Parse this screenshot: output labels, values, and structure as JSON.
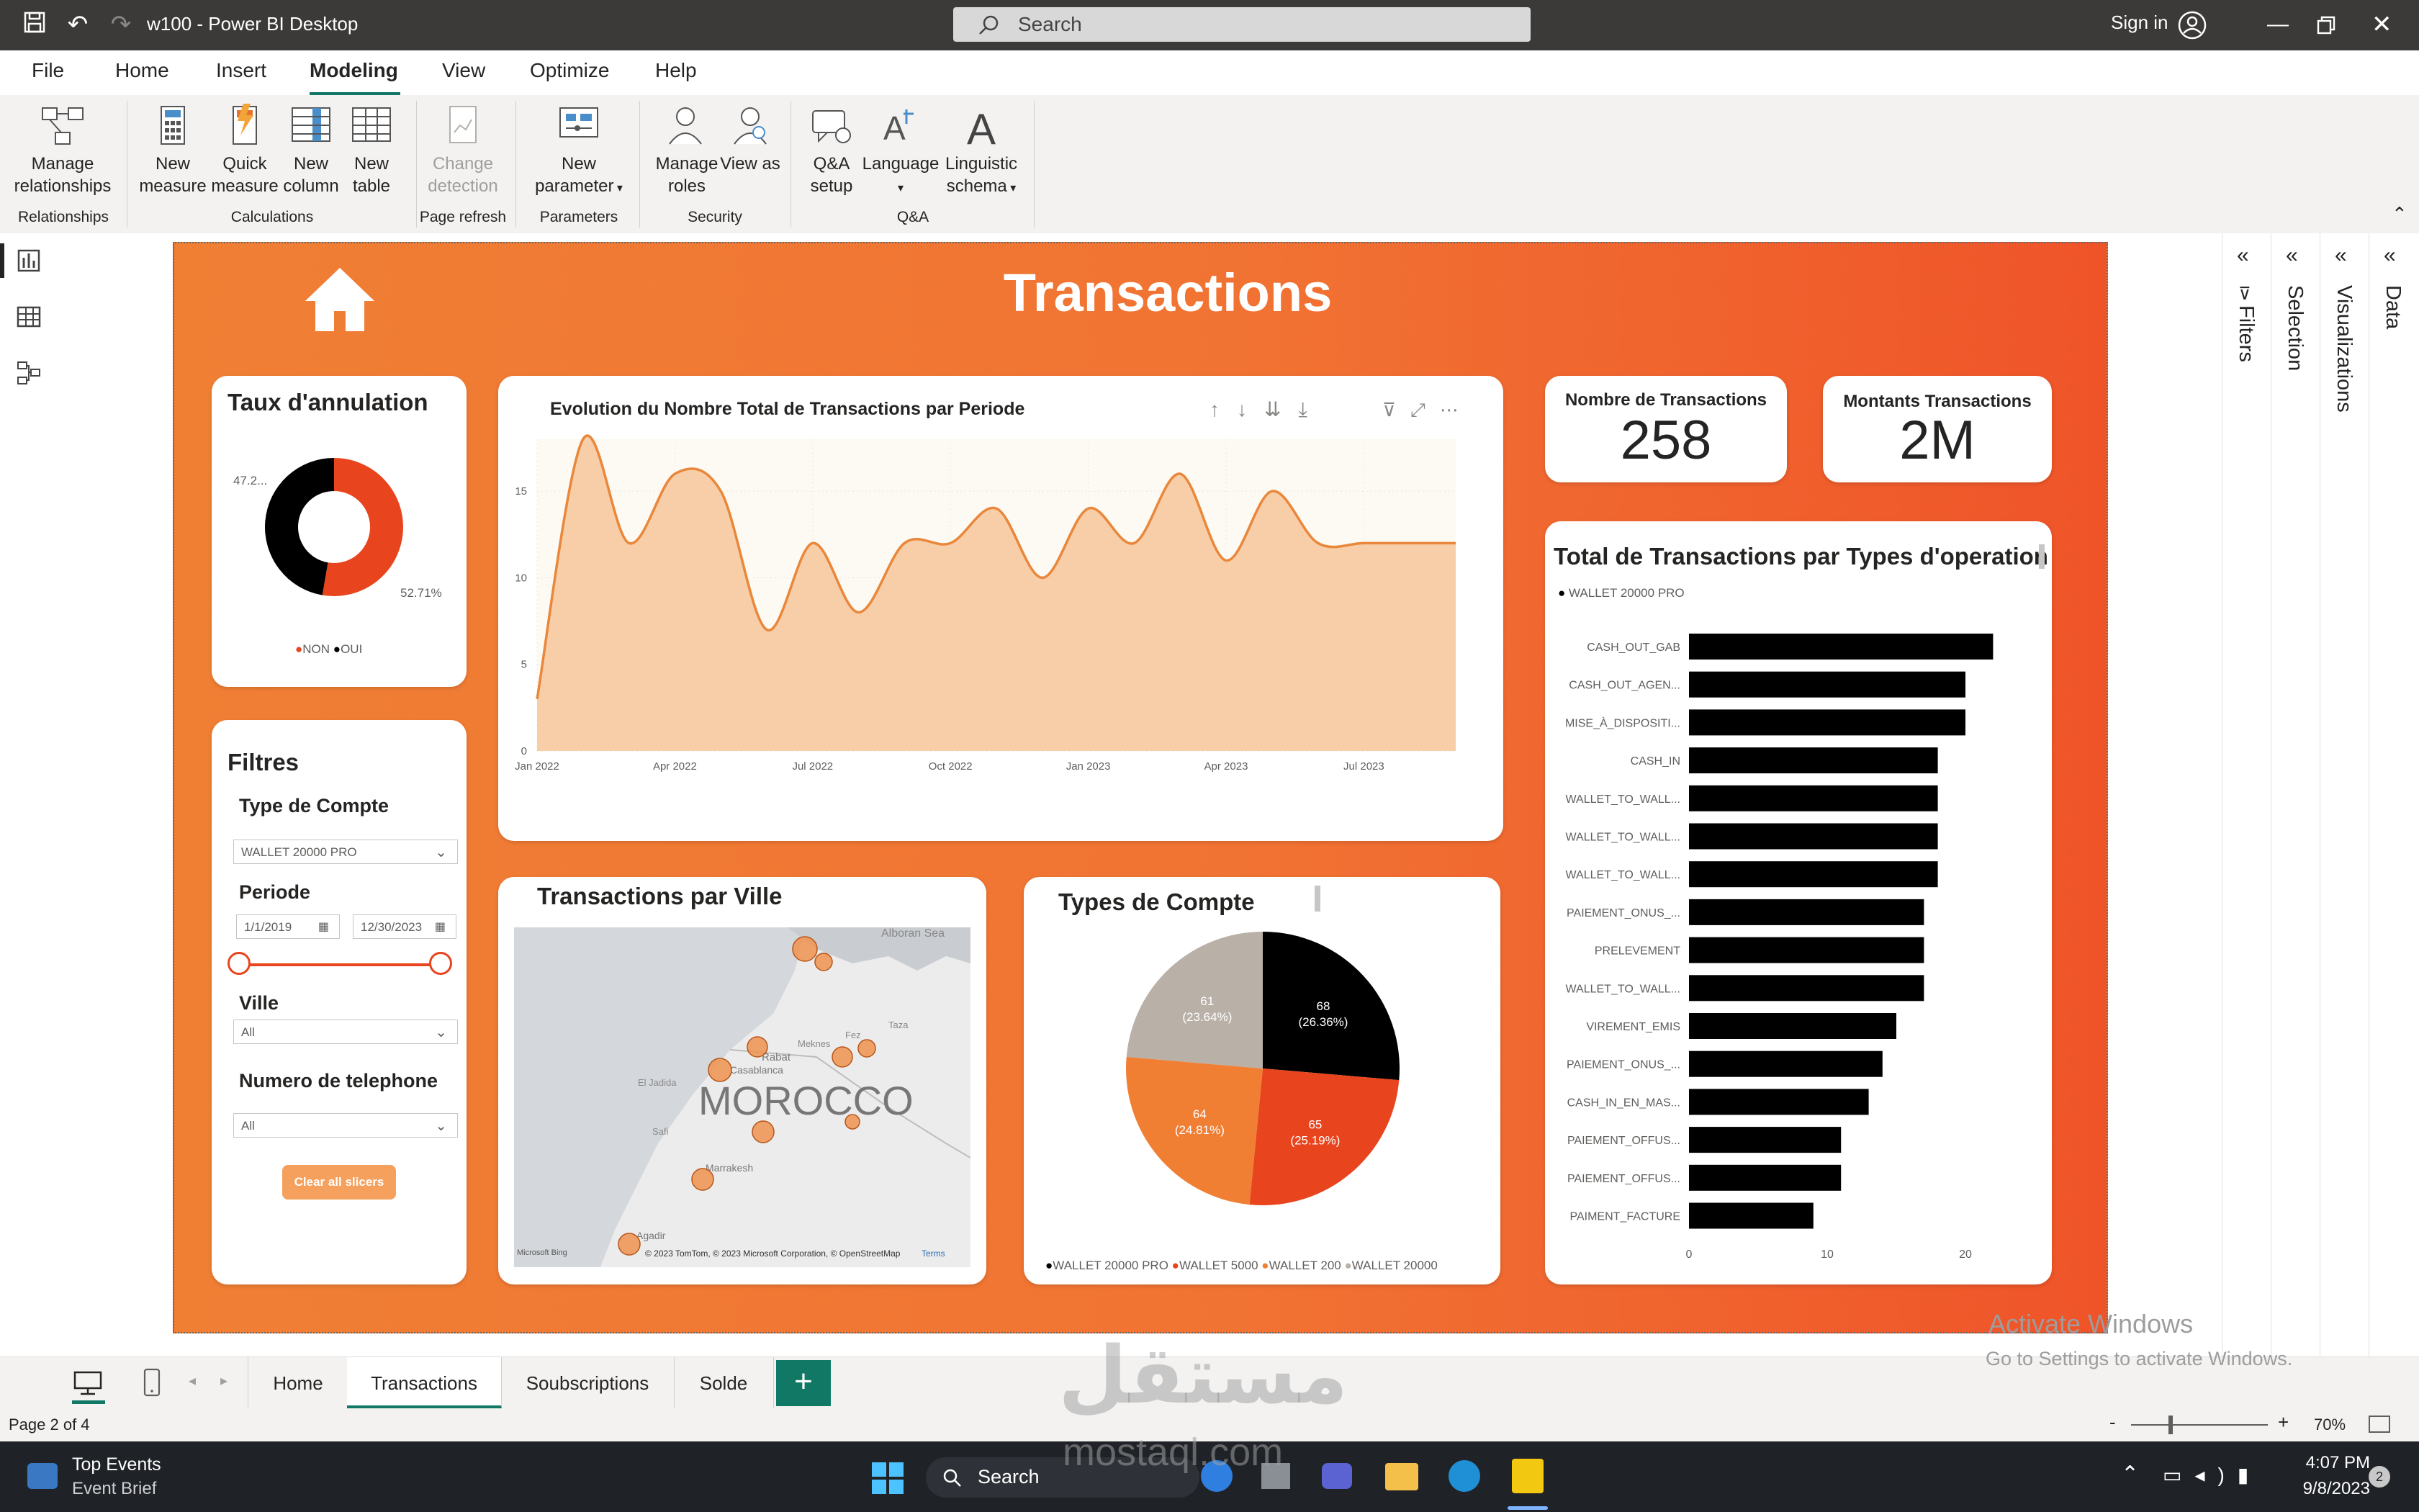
{
  "window": {
    "title": "w100 - Power BI Desktop",
    "search_placeholder": "Search",
    "sign_in": "Sign in"
  },
  "menu": {
    "items": [
      "File",
      "Home",
      "Insert",
      "Modeling",
      "View",
      "Optimize",
      "Help"
    ],
    "active": "Modeling"
  },
  "ribbon": {
    "buttons": {
      "manage_relationships": "Manage relationships",
      "new_measure": "New measure",
      "quick_measure": "Quick measure",
      "new_column": "New column",
      "new_table": "New table",
      "change_detection": "Change detection",
      "new_parameter": "New parameter",
      "manage_roles": "Manage roles",
      "view_as": "View as",
      "qa_setup": "Q&A setup",
      "language": "Language",
      "linguistic_schema": "Linguistic schema"
    },
    "groups": {
      "relationships": "Relationships",
      "calculations": "Calculations",
      "page_refresh": "Page refresh",
      "parameters": "Parameters",
      "security": "Security",
      "qa": "Q&A"
    }
  },
  "report": {
    "title": "Transactions",
    "cancel_rate": {
      "title": "Taux d'annulation",
      "label_oui": "47.2...",
      "label_non": "52.71%",
      "legend": [
        "NON",
        "OUI"
      ],
      "values": {
        "NON": 52.71,
        "OUI": 47.29
      }
    },
    "filters": {
      "title": "Filtres",
      "account_type_label": "Type de Compte",
      "account_type_value": "WALLET 20000 PRO",
      "period_label": "Periode",
      "date_start": "1/1/2019",
      "date_end": "12/30/2023",
      "city_label": "Ville",
      "city_value": "All",
      "phone_label": "Numero de telephone",
      "phone_value": "All",
      "clear_button": "Clear all slicers"
    },
    "kpis": {
      "count_label": "Nombre de Transactions",
      "count_value": "258",
      "amount_label": "Montants Transactions",
      "amount_value": "2M"
    },
    "map": {
      "title": "Transactions par Ville",
      "country": "MOROCCO",
      "places": [
        "Alboran Sea",
        "Taza",
        "Fez",
        "Meknes",
        "Rabat",
        "Casablanca",
        "El Jadida",
        "Safi",
        "Marrakesh",
        "Agadir"
      ],
      "attribution": "© 2023 TomTom, © 2023 Microsoft Corporation, © OpenStreetMap",
      "terms": "Terms",
      "bing": "Microsoft Bing"
    },
    "colors": {
      "black": "#000000",
      "red": "#e8451e",
      "orange": "#f07f34",
      "grey": "#b9b0a7",
      "area_fill": "#f7c9a0",
      "line": "#e9873b",
      "accent": "#117865"
    }
  },
  "chart_data": [
    {
      "type": "area",
      "title": "Evolution du Nombre Total de Transactions par Periode",
      "x": [
        "Jan 2022",
        "Feb 2022",
        "Mar 2022",
        "Apr 2022",
        "May 2022",
        "Jun 2022",
        "Jul 2022",
        "Aug 2022",
        "Sep 2022",
        "Oct 2022",
        "Nov 2022",
        "Dec 2022",
        "Jan 2023",
        "Feb 2023",
        "Mar 2023",
        "Apr 2023",
        "May 2023",
        "Jun 2023",
        "Jul 2023",
        "Aug 2023",
        "Sep 2023"
      ],
      "values": [
        3,
        18,
        12,
        16,
        15,
        7,
        12,
        8,
        12,
        12,
        14,
        10,
        14,
        12,
        16,
        11,
        15,
        12,
        12,
        12,
        12
      ],
      "tick_labels": [
        "Jan 2022",
        "Apr 2022",
        "Jul 2022",
        "Oct 2022",
        "Jan 2023",
        "Apr 2023",
        "Jul 2023"
      ],
      "ylim": [
        0,
        18
      ],
      "yticks": [
        0,
        5,
        10,
        15
      ],
      "grid": true
    },
    {
      "type": "pie",
      "title": "Types de Compte",
      "series": [
        {
          "name": "WALLET 20000 PRO",
          "value": 68,
          "label": "68",
          "pct": "(26.36%)"
        },
        {
          "name": "WALLET 5000",
          "value": 65,
          "label": "65",
          "pct": "(25.19%)"
        },
        {
          "name": "WALLET 200",
          "value": 64,
          "label": "64",
          "pct": "(24.81%)"
        },
        {
          "name": "WALLET 20000",
          "value": 61,
          "label": "61",
          "pct": "(23.64%)"
        }
      ]
    },
    {
      "type": "bar",
      "title": "Total de Transactions par Types d'operation",
      "legend": [
        "WALLET 20000 PRO"
      ],
      "categories": [
        "CASH_OUT_GAB",
        "CASH_OUT_AGEN...",
        "MISE_À_DISPOSITI...",
        "CASH_IN",
        "WALLET_TO_WALL...",
        "WALLET_TO_WALL...",
        "WALLET_TO_WALL...",
        "PAIEMENT_ONUS_...",
        "PRELEVEMENT",
        "WALLET_TO_WALL...",
        "VIREMENT_EMIS",
        "PAIEMENT_ONUS_...",
        "CASH_IN_EN_MAS...",
        "PAIEMENT_OFFUS...",
        "PAIEMENT_OFFUS...",
        "PAIMENT_FACTURE"
      ],
      "values": [
        22,
        20,
        20,
        18,
        18,
        18,
        18,
        17,
        17,
        17,
        15,
        14,
        13,
        11,
        11,
        9
      ],
      "xlim": [
        0,
        25
      ],
      "xticks": [
        0,
        10,
        20
      ]
    }
  ],
  "right_panes": [
    "Filters",
    "Selection",
    "Visualizations",
    "Data"
  ],
  "page_tabs": [
    "Home",
    "Transactions",
    "Soubscriptions",
    "Solde"
  ],
  "active_tab": "Transactions",
  "status": {
    "page": "Page 2 of 4",
    "zoom": "70%",
    "activate_line1": "Activate Windows",
    "activate_line2": "Go to Settings to activate Windows."
  },
  "taskbar": {
    "widget_title": "Top Events",
    "widget_sub": "Event Brief",
    "search": "Search",
    "time": "4:07 PM",
    "date": "9/8/2023",
    "notif": "2"
  },
  "watermark": {
    "arabic": "مستقل",
    "latin": "mostaql.com"
  }
}
